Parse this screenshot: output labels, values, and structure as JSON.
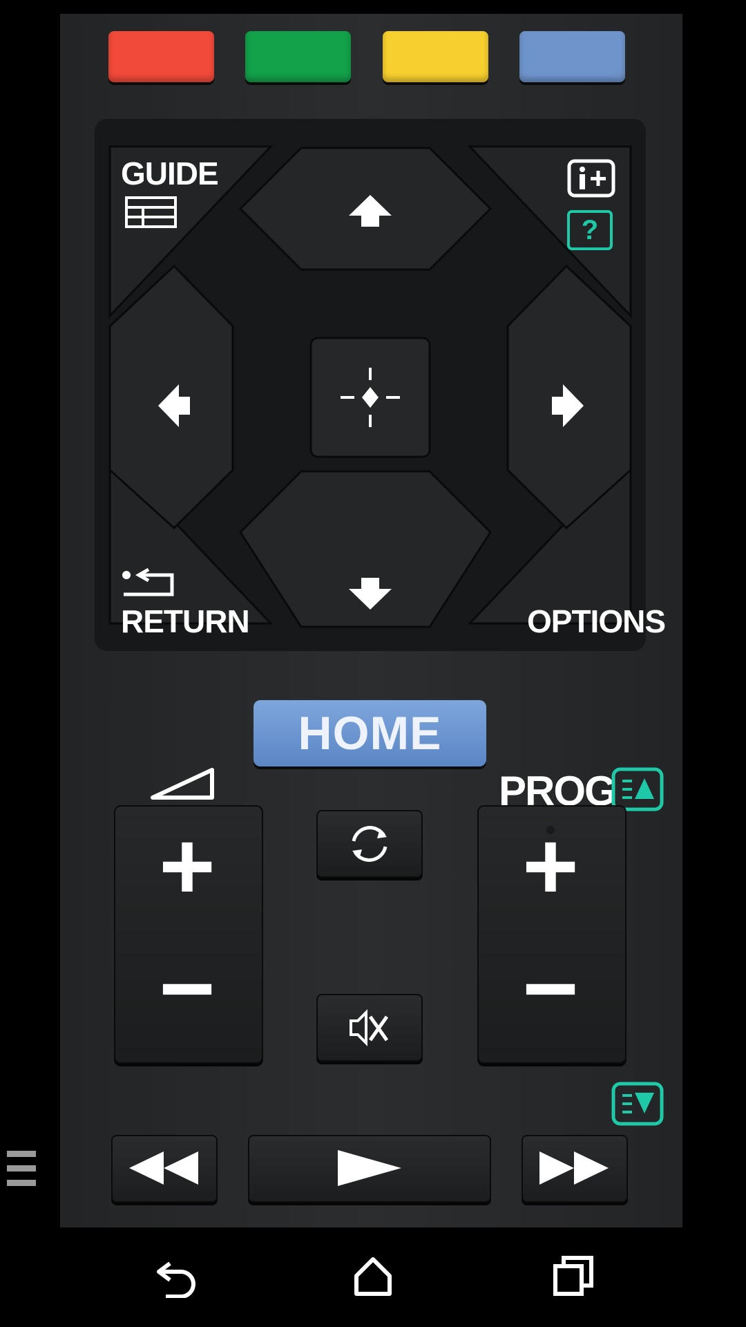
{
  "remote": {
    "color_buttons": [
      {
        "name": "red",
        "color": "#f24a3a"
      },
      {
        "name": "green",
        "color": "#13a14a"
      },
      {
        "name": "yellow",
        "color": "#f7cf2e"
      },
      {
        "name": "blue",
        "color": "#6f94cc"
      }
    ],
    "guide_label": "GUIDE",
    "return_label": "RETURN",
    "options_label": "OPTIONS",
    "help_label": "?",
    "home_label": "HOME",
    "prog_label": "PROG",
    "plus_symbol": "+",
    "minus_symbol": "−",
    "accent_color": "#1fc9a8",
    "icons": {
      "info": "info-plus-icon",
      "help": "help-icon",
      "guide": "guide-grid-icon",
      "return": "return-arrow-icon",
      "volume": "volume-ramp-icon",
      "input_cycle": "refresh-icon",
      "mute": "mute-icon",
      "rewind": "rewind-icon",
      "play": "play-icon",
      "fast_forward": "fast-forward-icon"
    }
  },
  "navbar": {
    "back": "back-icon",
    "home": "home-icon",
    "recents": "recents-icon"
  }
}
